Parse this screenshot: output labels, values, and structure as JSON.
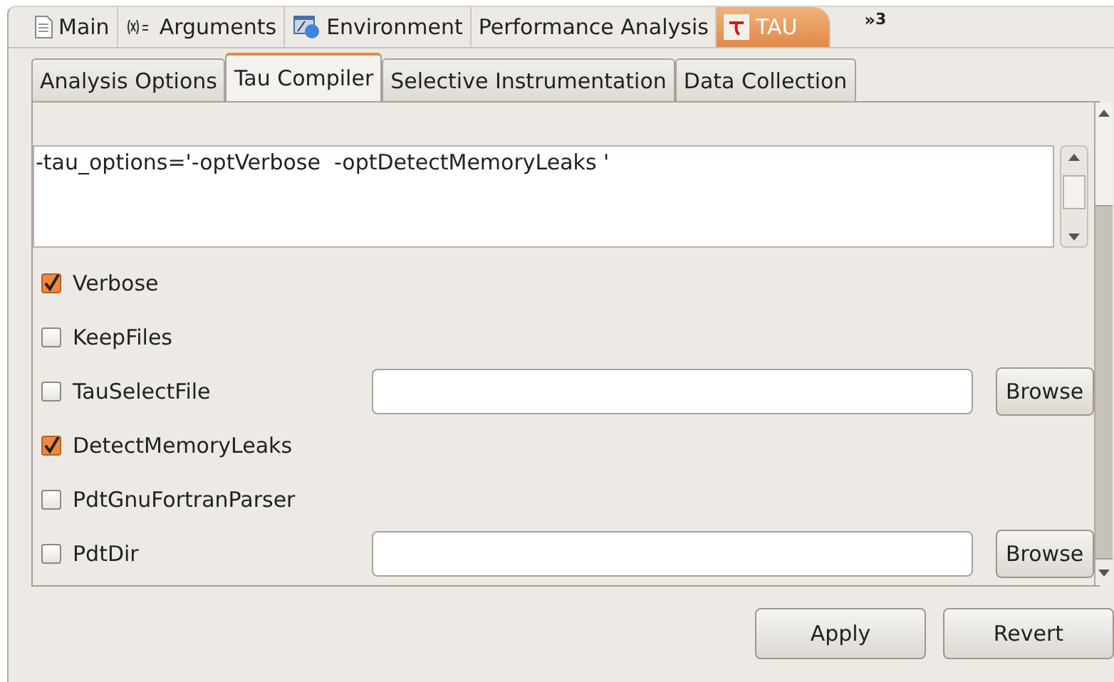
{
  "launch_tabs": [
    {
      "label": "Main",
      "kind": "document",
      "selected": false
    },
    {
      "label": "Arguments",
      "kind": "variable",
      "selected": false
    },
    {
      "label": "Environment",
      "kind": "environment",
      "selected": false
    },
    {
      "label": "Performance Analysis",
      "kind": "plain",
      "selected": false
    },
    {
      "label": "TAU",
      "kind": "tau",
      "selected": true
    }
  ],
  "overflow": {
    "chevron": "»",
    "count": "3"
  },
  "sub_tabs": [
    {
      "label": "Analysis Options",
      "selected": false
    },
    {
      "label": "Tau Compiler",
      "selected": true
    },
    {
      "label": "Selective Instrumentation",
      "selected": false
    },
    {
      "label": "Data Collection",
      "selected": false
    }
  ],
  "options_text": "-tau_options='-optVerbose  -optDetectMemoryLeaks '",
  "options": [
    {
      "kind": "check",
      "label": "Verbose",
      "checked": true
    },
    {
      "kind": "check",
      "label": "KeepFiles",
      "checked": false
    },
    {
      "kind": "file",
      "label": "TauSelectFile",
      "checked": false,
      "browse": "Browse"
    },
    {
      "kind": "check",
      "label": "DetectMemoryLeaks",
      "checked": true
    },
    {
      "kind": "check",
      "label": "PdtGnuFortranParser",
      "checked": false
    },
    {
      "kind": "file",
      "label": "PdtDir",
      "checked": false,
      "browse": "Browse"
    }
  ],
  "buttons": [
    "Apply",
    "Revert"
  ]
}
